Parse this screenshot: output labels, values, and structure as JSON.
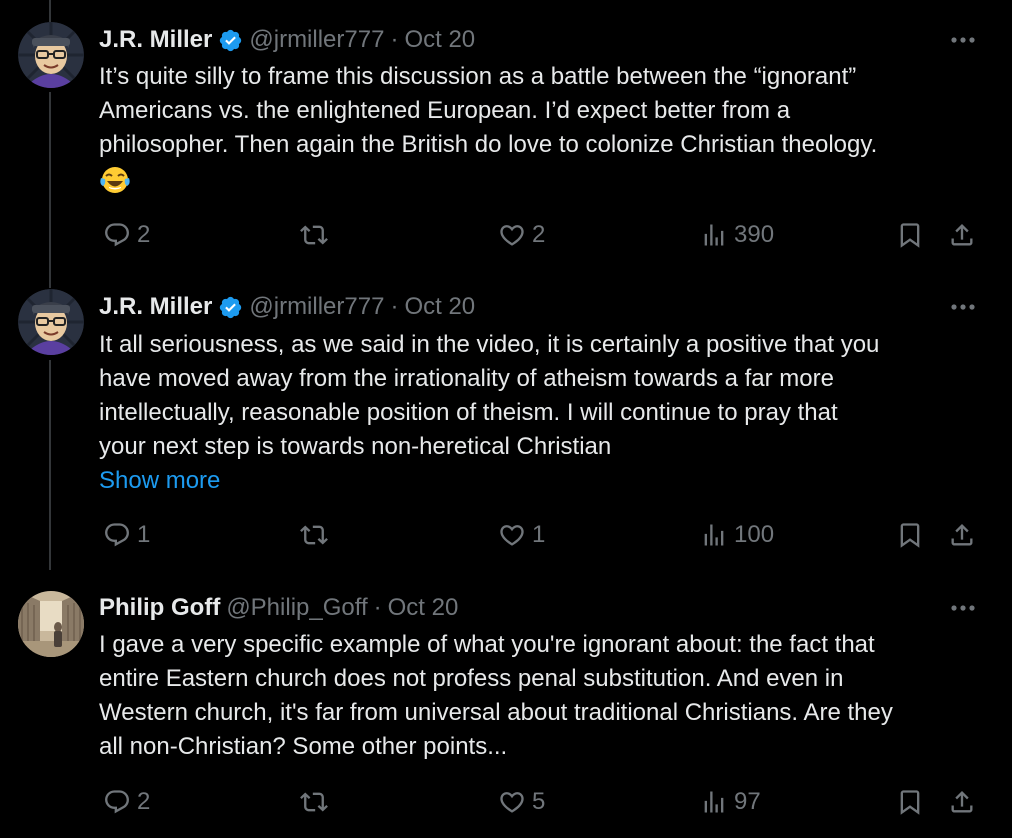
{
  "tweets": [
    {
      "name": "J.R. Miller",
      "handle": "@jrmiller777",
      "separator": "·",
      "date": "Oct 20",
      "lines": [
        "It’s quite silly to frame this discussion as a battle between the “ignorant”",
        "Americans vs. the enlightened European. I’d expect better from a",
        "philosopher. Then again the British do love to colonize Christian theology."
      ],
      "emoji": "face-with-tears-of-joy",
      "replies": "2",
      "retweets": "",
      "likes": "2",
      "views": "390"
    },
    {
      "name": "J.R. Miller",
      "handle": "@jrmiller777",
      "separator": "·",
      "date": "Oct 20",
      "lines": [
        "It all seriousness, as we said in the video, it is certainly a positive that you",
        "have moved away from the irrationality of atheism towards a far more",
        "intellectually, reasonable position of theism. I will continue to pray that",
        "your next step is towards non-heretical Christian"
      ],
      "show_more": "Show more",
      "replies": "1",
      "retweets": "",
      "likes": "1",
      "views": "100"
    },
    {
      "name": "Philip Goff",
      "handle": "@Philip_Goff",
      "separator": "·",
      "date": "Oct 20",
      "lines": [
        "I gave a very specific example of what you're ignorant about: the fact that",
        "entire Eastern church does not profess penal substitution. And even in",
        "Western church, it's far from universal about traditional Christians. Are they",
        "all non-Christian? Some other points..."
      ],
      "replies": "2",
      "retweets": "",
      "likes": "5",
      "views": "97"
    }
  ],
  "colors": {
    "background": "#000000",
    "text": "#e7e9ea",
    "muted": "#71767b",
    "link": "#1d9bf0",
    "verified": "#1d9bf0"
  }
}
